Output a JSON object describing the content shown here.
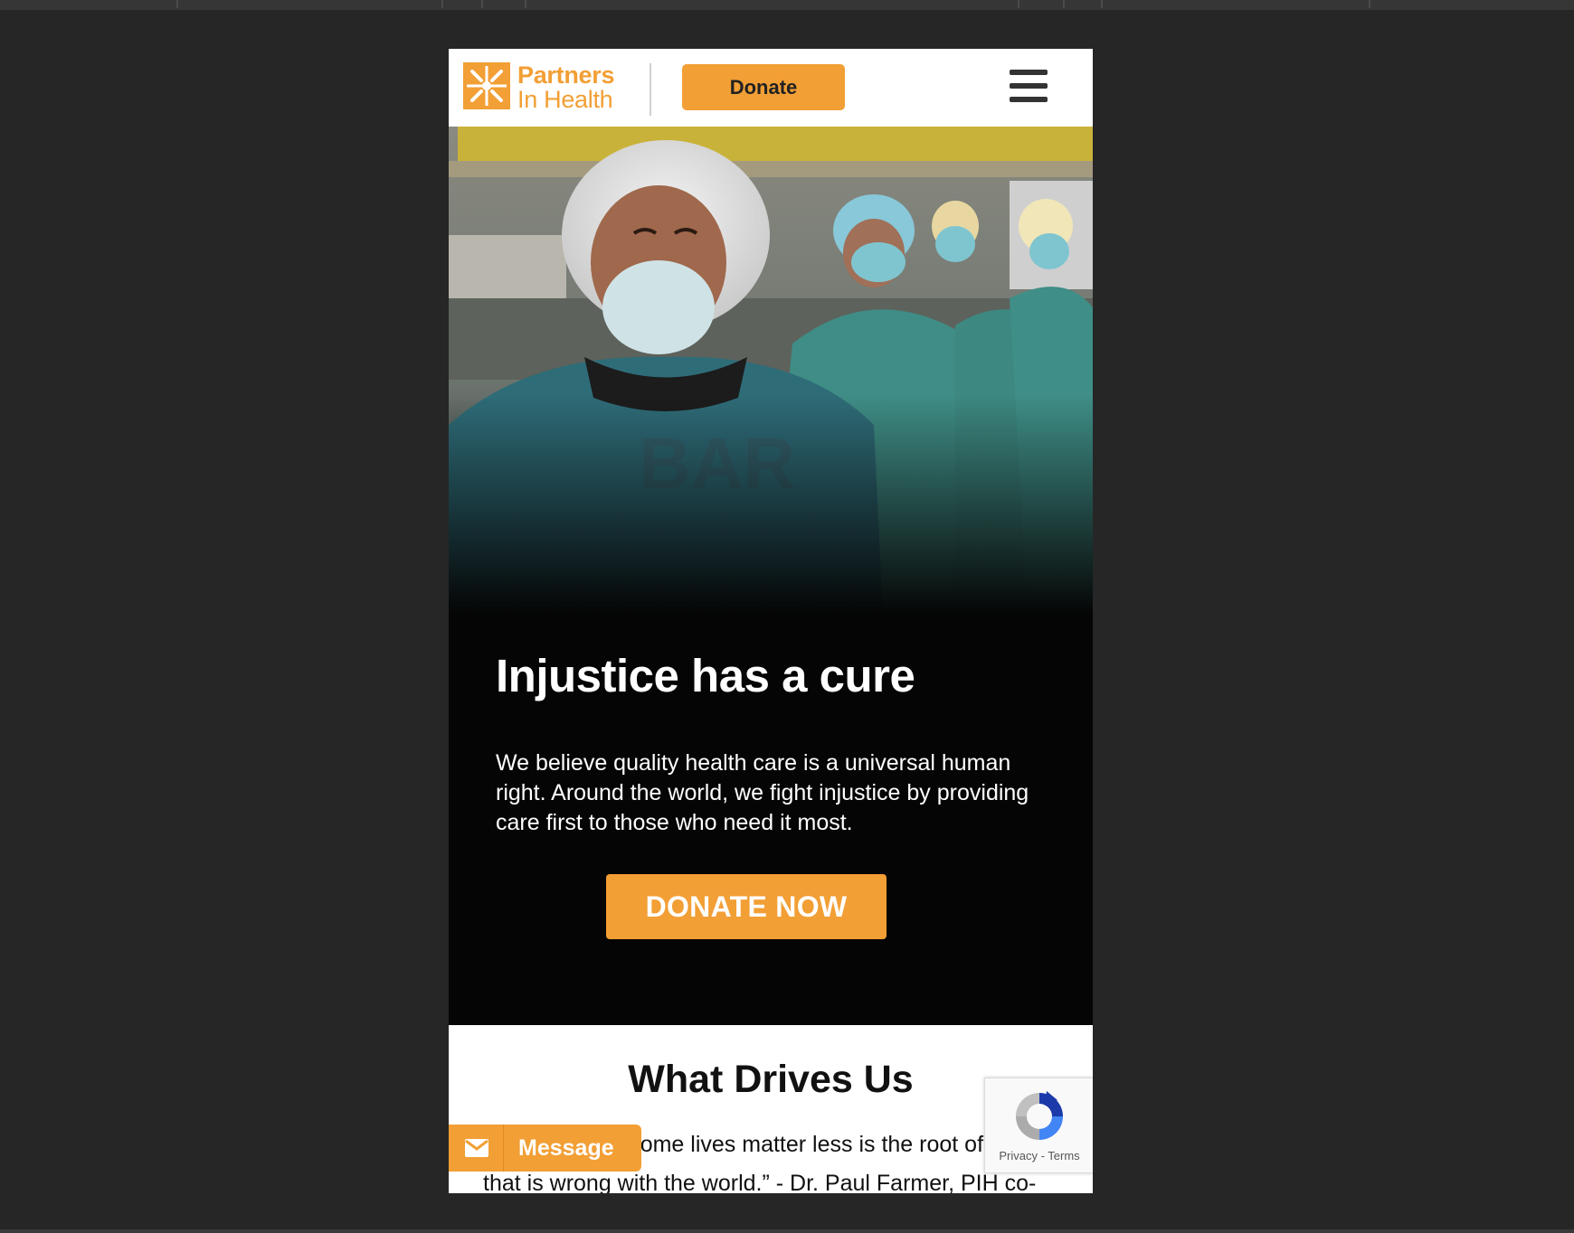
{
  "header": {
    "logo_line1": "Partners",
    "logo_line2": "In Health",
    "donate_label": "Donate"
  },
  "hero": {
    "title": "Injustice has a cure",
    "body": "We believe quality health care is a universal human right. Around the world, we fight injustice by providing care first to those who need it most.",
    "cta_label": "DONATE NOW"
  },
  "section": {
    "title": "What Drives Us",
    "quote_line1": "“The idea that some lives matter less is the root of all",
    "quote_line2": "that is wrong with the world.” - Dr. Paul Farmer, PIH co-"
  },
  "message_widget": {
    "label": "Message"
  },
  "recaptcha": {
    "privacy": "Privacy",
    "separator": " - ",
    "terms": "Terms"
  },
  "colors": {
    "brand_orange": "#f29f35",
    "page_background": "#262626",
    "hero_background": "#050505"
  },
  "icons": [
    "partners-in-health-logo",
    "hamburger-menu-icon",
    "envelope-icon",
    "recaptcha-icon"
  ]
}
